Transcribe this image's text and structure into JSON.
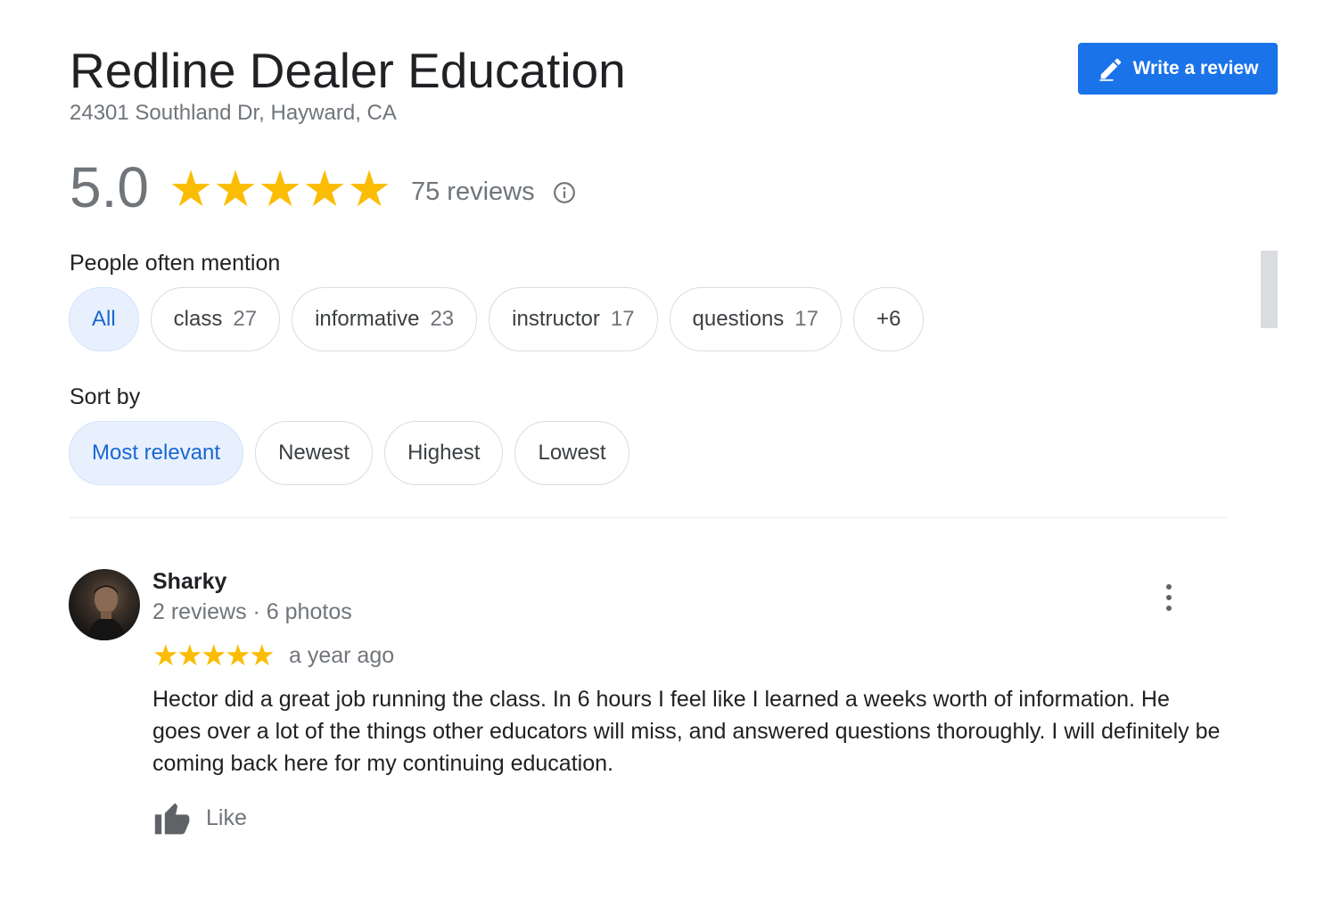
{
  "business": {
    "name": "Redline Dealer Education",
    "address": "24301 Southland Dr, Hayward, CA"
  },
  "actions": {
    "write_review_label": "Write a review"
  },
  "summary": {
    "rating": "5.0",
    "stars": 5,
    "review_count": "75 reviews",
    "info_icon": "info-icon"
  },
  "mentions": {
    "label": "People often mention",
    "chips": [
      {
        "label": "All",
        "count": "",
        "selected": true
      },
      {
        "label": "class",
        "count": "27",
        "selected": false
      },
      {
        "label": "informative",
        "count": "23",
        "selected": false
      },
      {
        "label": "instructor",
        "count": "17",
        "selected": false
      },
      {
        "label": "questions",
        "count": "17",
        "selected": false
      },
      {
        "label": "+6",
        "count": "",
        "selected": false
      }
    ]
  },
  "sort": {
    "label": "Sort by",
    "options": [
      {
        "label": "Most relevant",
        "selected": true
      },
      {
        "label": "Newest",
        "selected": false
      },
      {
        "label": "Highest",
        "selected": false
      },
      {
        "label": "Lowest",
        "selected": false
      }
    ]
  },
  "reviews": [
    {
      "author": "Sharky",
      "meta": "2 reviews · 6 photos",
      "stars": 5,
      "date": "a year ago",
      "text": "Hector did a great job running the class. In 6 hours I feel like I learned a weeks worth of information. He goes over a lot of the things other educators will miss, and answered questions thoroughly. I will definitely be coming back here for my continuing education.",
      "like_label": "Like",
      "more_icon": "more-vert-icon",
      "like_icon": "thumbs-up-icon"
    }
  ],
  "colors": {
    "accent": "#1a73e8",
    "star": "#fbbc04",
    "chip_active_bg": "#e8f0fe",
    "chip_active_text": "#1967d2",
    "muted_text": "#70757a"
  }
}
